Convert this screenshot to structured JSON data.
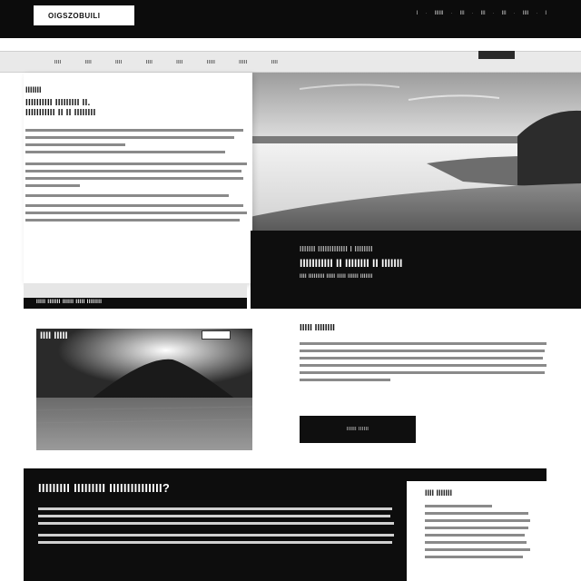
{
  "header": {
    "logo_text": "OIGSZOBUILI",
    "nav_items": [
      "I",
      "IIIIII",
      "III",
      "III",
      "III",
      "IIII",
      "I"
    ]
  },
  "subnav": {
    "items": [
      "IIII",
      "IIII",
      "IIII",
      "IIII",
      "IIII",
      "IIIII",
      "IIIII",
      "IIII"
    ]
  },
  "hero": {
    "heading_1": "IIIIIII",
    "heading_2": "IIIIIIIIII IIIIIIIII II.",
    "heading_3": "IIIIIIIIIII II II IIIIIIII",
    "label_bar": "IIIII IIIIIII IIIIII IIIII IIIIIIII",
    "dark_title_1": "IIIIIII IIIIIIIIIIIII I IIIIIIII",
    "dark_title_2": "IIIIIIIIIII II IIIIIIII II IIIIIII",
    "dark_sub": "IIII IIIIIIIII IIIII IIIII IIIIII IIIIIII"
  },
  "feature": {
    "tag": "IIII IIIII",
    "title": "IIIII IIIIIIII",
    "button_label": "IIIIII IIIIII"
  },
  "bottom": {
    "title": "IIIIIIIII IIIIIIIII IIIIIIIIIIIIIII?",
    "side_title": "IIII IIIIIII"
  },
  "colors": {
    "header_bg": "#0c0c0c",
    "accent_dark": "#0e0e0e",
    "panel_bg": "#ffffff"
  }
}
